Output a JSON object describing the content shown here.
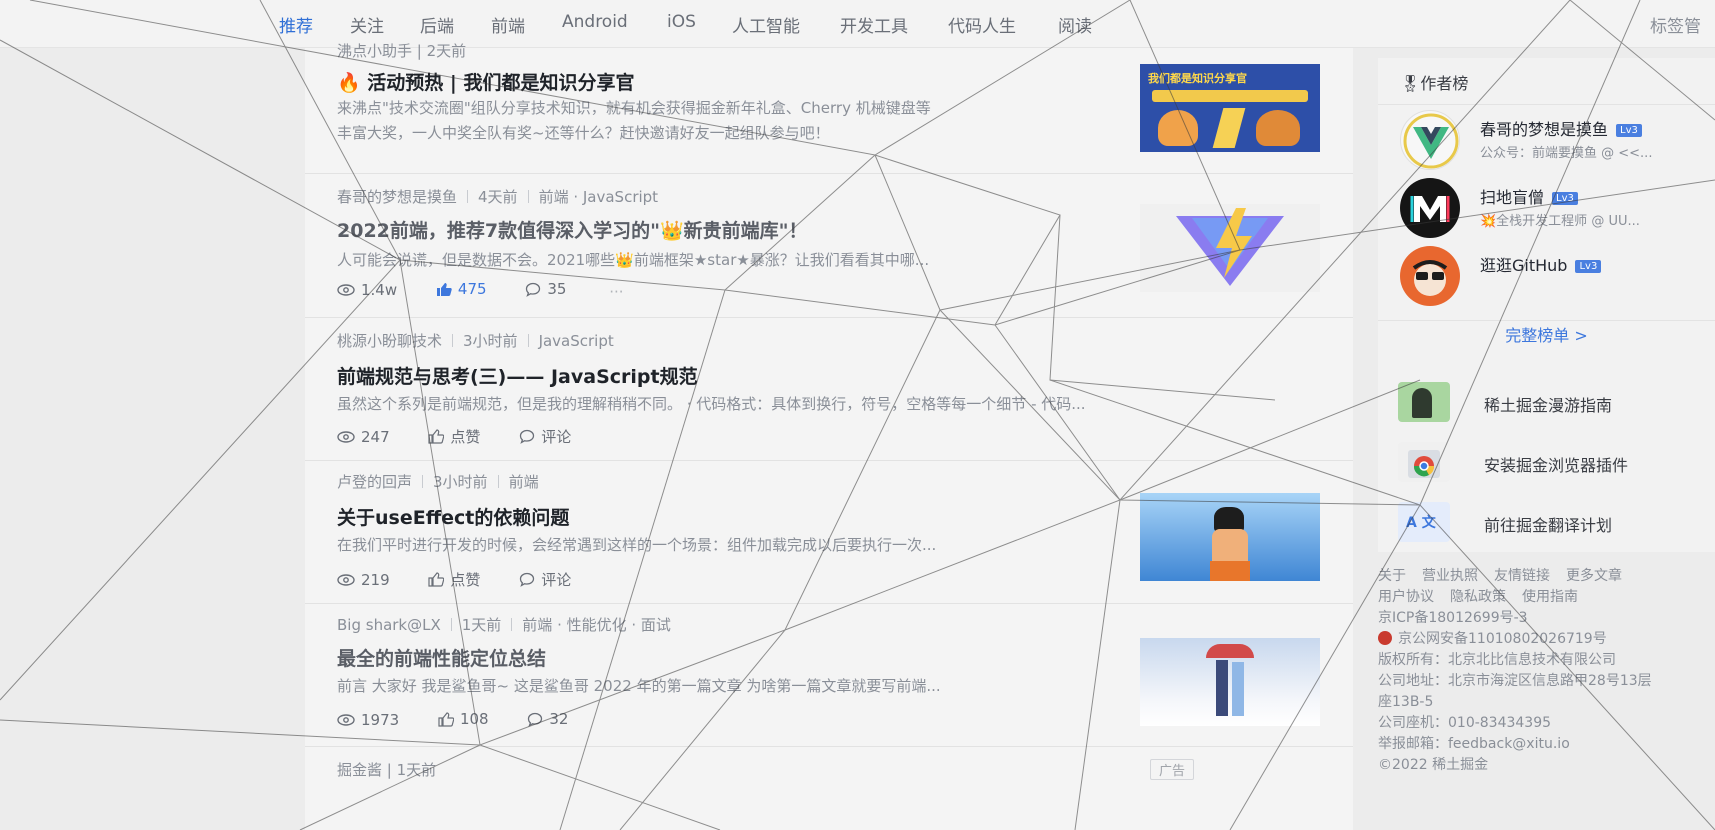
{
  "nav": {
    "tabs": [
      "推荐",
      "关注",
      "后端",
      "前端",
      "Android",
      "iOS",
      "人工智能",
      "开发工具",
      "代码人生",
      "阅读"
    ],
    "right": "标签管"
  },
  "feed": {
    "top_item": {
      "meta": "沸点小助手  |  2天前",
      "title": "🔥 活动预热 | 我们都是知识分享官",
      "desc1": "来沸点\"技术交流圈\"组队分享技术知识，就有机会获得掘金新年礼盒、Cherry 机械键盘等",
      "desc2": "丰富大奖，一人中奖全队有奖~还等什么？赶快邀请好友一起组队参与吧！",
      "thumb_text": "我们都是知识分享官"
    },
    "articles": [
      {
        "author": "春哥的梦想是摸鱼",
        "time": "4天前",
        "tags": "前端 · JavaScript",
        "title": "2022前端，推荐7款值得深入学习的\"👑新贵前端库\"！",
        "desc": "人可能会说谎，但是数据不会。2021哪些👑前端框架★star★暴涨？让我们看看其中哪...",
        "views": "1.4w",
        "likes": "475",
        "comments": "35"
      },
      {
        "author": "桃源小盼聊技术",
        "time": "3小时前",
        "tags": "JavaScript",
        "title": "前端规范与思考(三)—— JavaScript规范",
        "desc": "虽然这个系列是前端规范，但是我的理解稍稍不同。 · 代码格式：具体到换行，符号，空格等每一个细节 - 代码...",
        "views": "247",
        "likes": "点赞",
        "comments": "评论"
      },
      {
        "author": "卢登的回声",
        "time": "3小时前",
        "tags": "前端",
        "title": "关于useEffect的依赖问题",
        "desc": "在我们平时进行开发的时候，会经常遇到这样的一个场景：组件加载完成以后要执行一次...",
        "views": "219",
        "likes": "点赞",
        "comments": "评论"
      },
      {
        "author": "Big shark@LX",
        "time": "1天前",
        "tags": "前端 · 性能优化 · 面试",
        "title": "最全的前端性能定位总结",
        "desc": "前言 大家好 我是鲨鱼哥~ 这是鲨鱼哥 2022 年的第一篇文章 为啥第一篇文章就要写前端...",
        "views": "1973",
        "likes": "108",
        "comments": "32"
      }
    ],
    "bottom_item": {
      "meta": "掘金酱  |  1天前",
      "badge": "广告"
    }
  },
  "sidebar": {
    "rank_title": "🎖作者榜",
    "authors": [
      {
        "name": "春哥的梦想是摸鱼",
        "level": "Lv3",
        "desc": "公众号：前端要摸鱼 @ <<..."
      },
      {
        "name": "扫地盲僧",
        "level": "Lv3",
        "desc": "💥全栈开发工程师 @ UU..."
      },
      {
        "name": "逛逛GitHub",
        "level": "Lv3",
        "desc": ""
      }
    ],
    "full_rank": "完整榜单 >",
    "links": [
      {
        "label": "稀土掘金漫游指南",
        "icon": "guide-icon"
      },
      {
        "label": "安装掘金浏览器插件",
        "icon": "chrome-icon"
      },
      {
        "label": "前往掘金翻译计划",
        "icon": "translate-icon"
      }
    ],
    "translate_icon_text": "A 文",
    "footer": {
      "row1": [
        "关于",
        "营业执照",
        "友情链接",
        "更多文章"
      ],
      "row2": [
        "用户协议",
        "隐私政策",
        "使用指南"
      ],
      "icp": "京ICP备18012699号-3",
      "police": "京公网安备11010802026719号",
      "copyright": "版权所有：北京北比信息技术有限公司",
      "address": "公司地址：北京市海淀区信息路甲28号13层",
      "address2": "座13B-5",
      "phone": "公司座机：010-83434395",
      "email": "举报邮箱：feedback@xitu.io",
      "year": "©2022 稀土掘金"
    }
  }
}
